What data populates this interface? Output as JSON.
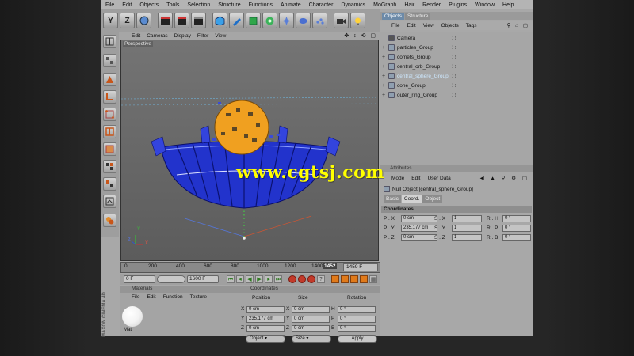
{
  "menu": [
    "File",
    "Edit",
    "Objects",
    "Tools",
    "Selection",
    "Structure",
    "Functions",
    "Animate",
    "Character",
    "Dynamics",
    "MoGraph",
    "Hair",
    "Render",
    "Plugins",
    "Window",
    "Help"
  ],
  "toolbar": {
    "y_axis_label": "Y",
    "z_axis_label": "Z"
  },
  "viewport": {
    "menu": [
      "Edit",
      "Cameras",
      "Display",
      "Filter",
      "View"
    ],
    "label": "Perspective",
    "axis_labels": {
      "y": "Y",
      "z": "Z",
      "x": "X"
    }
  },
  "timeline": {
    "ticks": [
      "0",
      "200",
      "400",
      "600",
      "800",
      "1000",
      "1200",
      "1400"
    ],
    "current_frame": "1452",
    "end_frame": "1459 F"
  },
  "transport": {
    "start_field": "0 F",
    "end_field": "1600 F"
  },
  "materials": {
    "header": "Materials",
    "menu": [
      "File",
      "Edit",
      "Function",
      "Texture"
    ],
    "material_name": "Mat"
  },
  "coordinates_panel": {
    "header": "Coordinates",
    "columns": [
      "Position",
      "Size",
      "Rotation"
    ],
    "rows": [
      {
        "axis": "X",
        "position": "0 cm",
        "size_axis": "X",
        "size": "0 cm",
        "rot_axis": "H",
        "rotation": "0 °"
      },
      {
        "axis": "Y",
        "position": "235.177 cm",
        "size_axis": "Y",
        "size": "0 cm",
        "rot_axis": "P",
        "rotation": "0 °"
      },
      {
        "axis": "Z",
        "position": "0 cm",
        "size_axis": "Z",
        "size": "0 cm",
        "rot_axis": "B",
        "rotation": "0 °"
      }
    ],
    "mode_dropdown": "Object",
    "size_dropdown": "Size",
    "apply_label": "Apply"
  },
  "object_manager": {
    "tabs": [
      "Objects",
      "Structure"
    ],
    "menu": [
      "File",
      "Edit",
      "View",
      "Objects",
      "Tags"
    ],
    "items": [
      {
        "name": "Camera",
        "type": "camera",
        "selected": false
      },
      {
        "name": "particles_Group",
        "type": "null",
        "selected": false
      },
      {
        "name": "comets_Group",
        "type": "null",
        "selected": false
      },
      {
        "name": "central_orb_Group",
        "type": "null",
        "selected": false
      },
      {
        "name": "central_sphere_Group",
        "type": "null",
        "selected": true
      },
      {
        "name": "cone_Group",
        "type": "null",
        "selected": false
      },
      {
        "name": "outer_ring_Group",
        "type": "null",
        "selected": false
      }
    ]
  },
  "attribute_manager": {
    "header": "Attributes",
    "menu": [
      "Mode",
      "Edit",
      "User Data"
    ],
    "object_title": "Null Object [central_sphere_Group]",
    "tabs": [
      "Basic",
      "Coord.",
      "Object"
    ],
    "active_tab": "Coord.",
    "section": "Coordinates",
    "rows": [
      {
        "p_label": "P . X",
        "p_value": "0 cm",
        "s_label": "S . X",
        "s_value": "1",
        "r_label": "R . H",
        "r_value": "0 °"
      },
      {
        "p_label": "P . Y",
        "p_value": "235.177 cm",
        "s_label": "S . Y",
        "s_value": "1",
        "r_label": "R . P",
        "r_value": "0 °"
      },
      {
        "p_label": "P . Z",
        "p_value": "0 cm",
        "s_label": "S . Z",
        "s_value": "1",
        "r_label": "R . B",
        "r_value": "0 °"
      }
    ]
  },
  "watermark": "www.cgtsj.com",
  "brand": "MAXON CINEMA 4D",
  "colors": {
    "accent": "#e07a1a",
    "selection": "#6c8aa8",
    "bowl_blue": "#2233cc",
    "sphere_orange": "#f0a020",
    "watermark": "#ffff00"
  }
}
